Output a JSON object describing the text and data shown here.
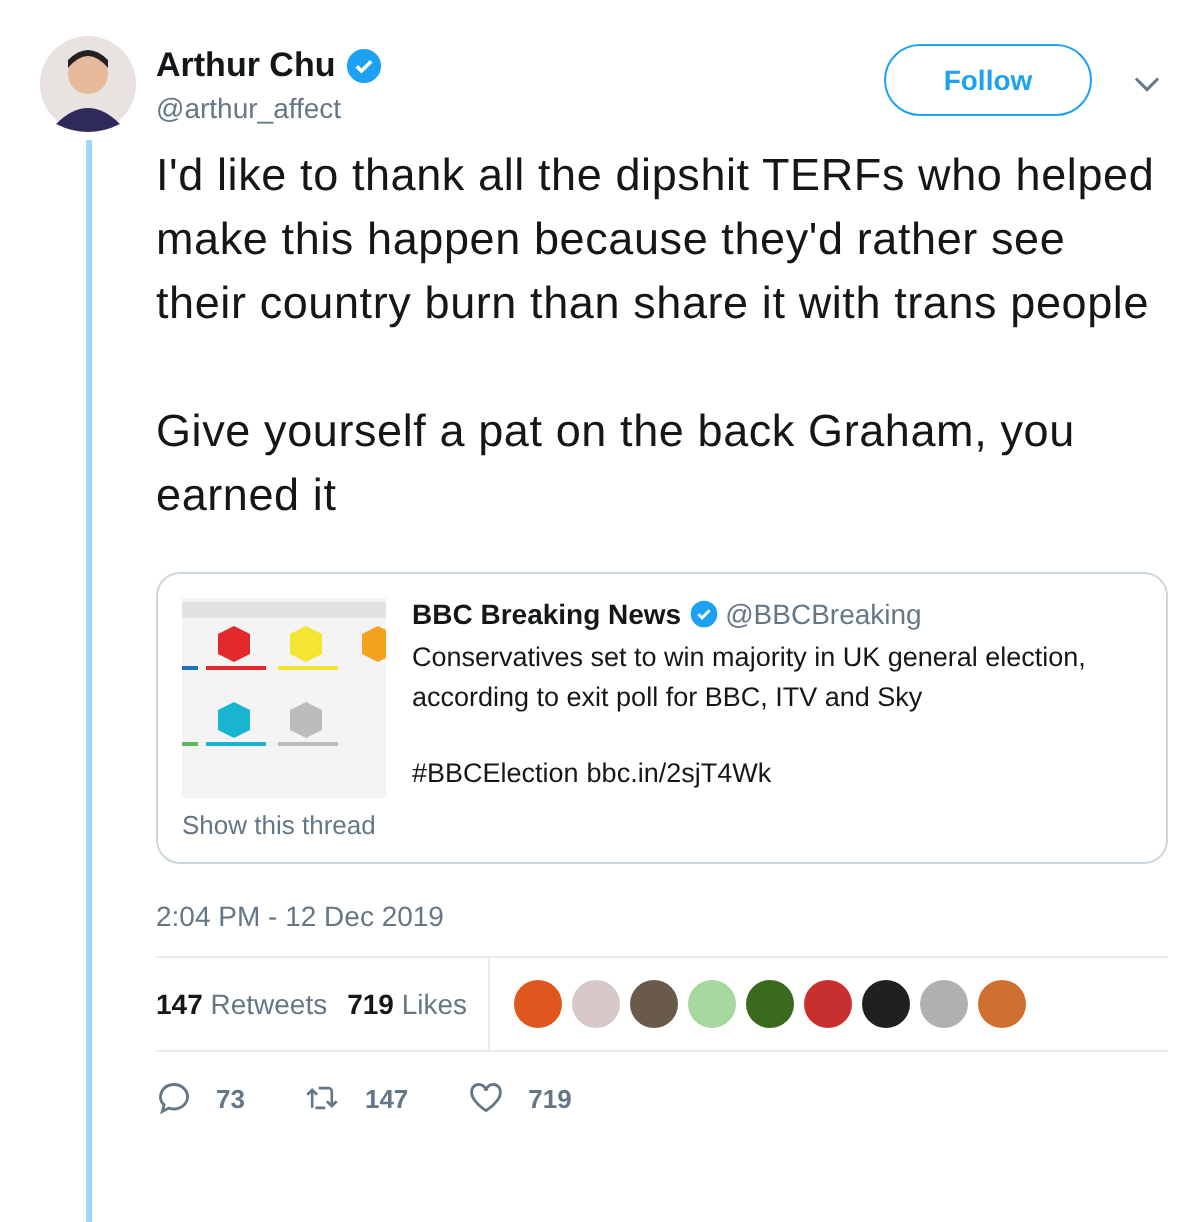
{
  "author": {
    "name": "Arthur Chu",
    "verified": true,
    "handle": "@arthur_affect"
  },
  "follow_button": "Follow",
  "tweet_text": [
    "I'd like to thank all the dipshit TERFs who helped make this happen because they'd rather see their country burn than share it with trans people",
    "Give yourself a pat on the back Graham, you earned it"
  ],
  "quoted_tweet": {
    "name": "BBC Breaking News",
    "verified": true,
    "handle": "@BBCBreaking",
    "text": "Conservatives set to win majority in UK general election, according to exit poll for BBC, ITV and Sky",
    "hashtag": "#BBCElection",
    "link": "bbc.in/2sjT4Wk",
    "show_thread": "Show this thread"
  },
  "timestamp": "2:04 PM - 12 Dec 2019",
  "stats": [
    {
      "count": "147",
      "label": "Retweets"
    },
    {
      "count": "719",
      "label": "Likes"
    }
  ],
  "likers": [
    {
      "color": "#e0561f"
    },
    {
      "color": "#d8c8c8"
    },
    {
      "color": "#6a5a4a"
    },
    {
      "color": "#a8d8a0"
    },
    {
      "color": "#3a6a20"
    },
    {
      "color": "#c83030"
    },
    {
      "color": "#202020"
    },
    {
      "color": "#b0b0b0"
    },
    {
      "color": "#d07030"
    }
  ],
  "actions": [
    {
      "kind": "reply",
      "count": "73"
    },
    {
      "kind": "retweet",
      "count": "147"
    },
    {
      "kind": "like",
      "count": "719"
    }
  ]
}
